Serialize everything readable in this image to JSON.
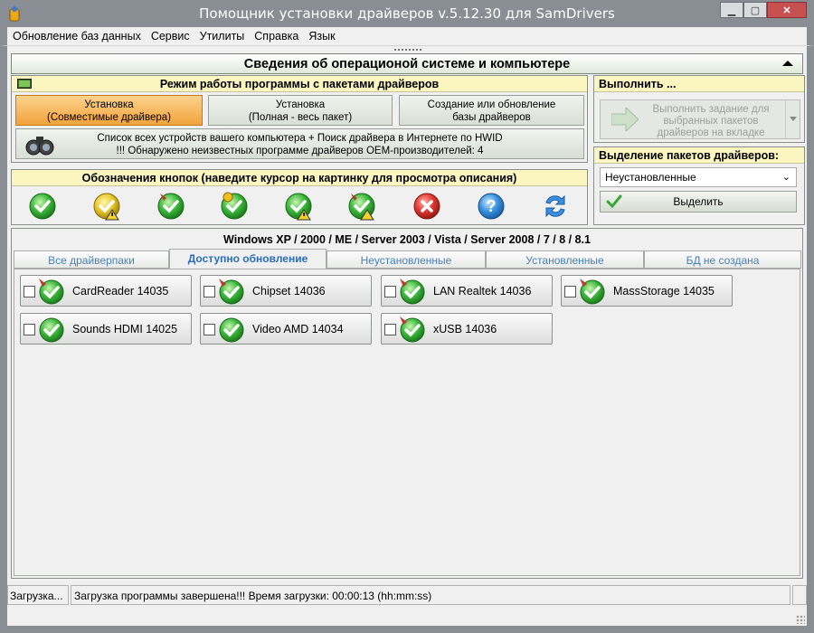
{
  "window": {
    "title": "Помощник установки драйверов v.5.12.30 для SamDrivers",
    "minimize": "▁",
    "maximize": "▢",
    "close": "✕"
  },
  "menu": [
    "Обновление баз данных",
    "Сервис",
    "Утилиты",
    "Справка",
    "Язык"
  ],
  "system_header": "Сведения об операционой системе и компьютере",
  "mode_panel": {
    "title": "Режим работы программы с пакетами драйверов",
    "buttons": [
      {
        "line1": "Установка",
        "line2": "(Совместимые драйвера)",
        "active": true
      },
      {
        "line1": "Установка",
        "line2": "(Полная - весь пакет)",
        "active": false
      },
      {
        "line1": "Создание или обновление",
        "line2": "базы драйверов",
        "active": false
      }
    ],
    "hwid_line1": "Список всех устройств вашего компьютера + Поиск драйвера в Интернете по HWID",
    "hwid_line2": "!!! Обнаружено неизвестных программе драйверов OEM-производителей: 4"
  },
  "legend_panel": {
    "title": "Обозначения кнопок (наведите курсор на картинку для просмотра описания)",
    "icons": [
      "green-check-icon",
      "yellow-check-warning-icon",
      "pinned-green-check-icon",
      "yellow-green-check-icon",
      "green-check-warning-icon",
      "pinned-check-warning-icon",
      "red-cross-icon",
      "help-icon",
      "refresh-arrows-icon"
    ]
  },
  "execute_panel": {
    "title": "Выполнить ...",
    "button": "Выполнить задание для выбранных пакетов драйверов на вкладке"
  },
  "selection_panel": {
    "title": "Выделение пакетов драйверов:",
    "combo_value": "Неустановленные",
    "select_button": "Выделить"
  },
  "os_line": "Windows XP / 2000 / ME / Server 2003 / Vista / Server 2008 / 7 / 8 / 8.1",
  "tabs": [
    "Все драйверпаки",
    "Доступно обновление",
    "Неустановленные",
    "Установленные",
    "БД не создана"
  ],
  "active_tab": 1,
  "packages": [
    {
      "label": "CardReader 14035"
    },
    {
      "label": "Chipset 14036"
    },
    {
      "label": "LAN Realtek 14036"
    },
    {
      "label": "MassStorage 14035"
    },
    {
      "label": "Sounds HDMI 14025"
    },
    {
      "label": "Video AMD 14034"
    },
    {
      "label": "xUSB 14036"
    }
  ],
  "status": {
    "left": "Загрузка...",
    "message": "Загрузка программы завершена!!! Время загрузки: 00:00:13 (hh:mm:ss)"
  },
  "colors": {
    "panel_header": "#fbf6bf",
    "active_mode": "#f2a23a",
    "tab_text": "#4a80b8",
    "check_green": "#2aa52a"
  }
}
